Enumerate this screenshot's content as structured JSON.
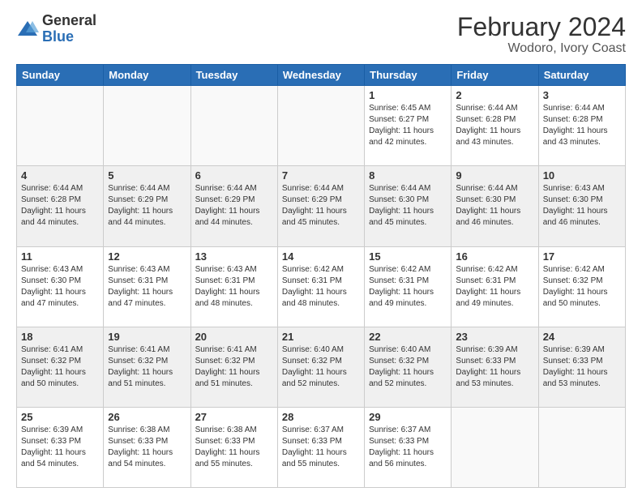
{
  "logo": {
    "general": "General",
    "blue": "Blue"
  },
  "header": {
    "title": "February 2024",
    "subtitle": "Wodoro, Ivory Coast"
  },
  "days_of_week": [
    "Sunday",
    "Monday",
    "Tuesday",
    "Wednesday",
    "Thursday",
    "Friday",
    "Saturday"
  ],
  "weeks": [
    [
      {
        "day": "",
        "info": ""
      },
      {
        "day": "",
        "info": ""
      },
      {
        "day": "",
        "info": ""
      },
      {
        "day": "",
        "info": ""
      },
      {
        "day": "1",
        "info": "Sunrise: 6:45 AM\nSunset: 6:27 PM\nDaylight: 11 hours and 42 minutes."
      },
      {
        "day": "2",
        "info": "Sunrise: 6:44 AM\nSunset: 6:28 PM\nDaylight: 11 hours and 43 minutes."
      },
      {
        "day": "3",
        "info": "Sunrise: 6:44 AM\nSunset: 6:28 PM\nDaylight: 11 hours and 43 minutes."
      }
    ],
    [
      {
        "day": "4",
        "info": "Sunrise: 6:44 AM\nSunset: 6:28 PM\nDaylight: 11 hours and 44 minutes."
      },
      {
        "day": "5",
        "info": "Sunrise: 6:44 AM\nSunset: 6:29 PM\nDaylight: 11 hours and 44 minutes."
      },
      {
        "day": "6",
        "info": "Sunrise: 6:44 AM\nSunset: 6:29 PM\nDaylight: 11 hours and 44 minutes."
      },
      {
        "day": "7",
        "info": "Sunrise: 6:44 AM\nSunset: 6:29 PM\nDaylight: 11 hours and 45 minutes."
      },
      {
        "day": "8",
        "info": "Sunrise: 6:44 AM\nSunset: 6:30 PM\nDaylight: 11 hours and 45 minutes."
      },
      {
        "day": "9",
        "info": "Sunrise: 6:44 AM\nSunset: 6:30 PM\nDaylight: 11 hours and 46 minutes."
      },
      {
        "day": "10",
        "info": "Sunrise: 6:43 AM\nSunset: 6:30 PM\nDaylight: 11 hours and 46 minutes."
      }
    ],
    [
      {
        "day": "11",
        "info": "Sunrise: 6:43 AM\nSunset: 6:30 PM\nDaylight: 11 hours and 47 minutes."
      },
      {
        "day": "12",
        "info": "Sunrise: 6:43 AM\nSunset: 6:31 PM\nDaylight: 11 hours and 47 minutes."
      },
      {
        "day": "13",
        "info": "Sunrise: 6:43 AM\nSunset: 6:31 PM\nDaylight: 11 hours and 48 minutes."
      },
      {
        "day": "14",
        "info": "Sunrise: 6:42 AM\nSunset: 6:31 PM\nDaylight: 11 hours and 48 minutes."
      },
      {
        "day": "15",
        "info": "Sunrise: 6:42 AM\nSunset: 6:31 PM\nDaylight: 11 hours and 49 minutes."
      },
      {
        "day": "16",
        "info": "Sunrise: 6:42 AM\nSunset: 6:31 PM\nDaylight: 11 hours and 49 minutes."
      },
      {
        "day": "17",
        "info": "Sunrise: 6:42 AM\nSunset: 6:32 PM\nDaylight: 11 hours and 50 minutes."
      }
    ],
    [
      {
        "day": "18",
        "info": "Sunrise: 6:41 AM\nSunset: 6:32 PM\nDaylight: 11 hours and 50 minutes."
      },
      {
        "day": "19",
        "info": "Sunrise: 6:41 AM\nSunset: 6:32 PM\nDaylight: 11 hours and 51 minutes."
      },
      {
        "day": "20",
        "info": "Sunrise: 6:41 AM\nSunset: 6:32 PM\nDaylight: 11 hours and 51 minutes."
      },
      {
        "day": "21",
        "info": "Sunrise: 6:40 AM\nSunset: 6:32 PM\nDaylight: 11 hours and 52 minutes."
      },
      {
        "day": "22",
        "info": "Sunrise: 6:40 AM\nSunset: 6:32 PM\nDaylight: 11 hours and 52 minutes."
      },
      {
        "day": "23",
        "info": "Sunrise: 6:39 AM\nSunset: 6:33 PM\nDaylight: 11 hours and 53 minutes."
      },
      {
        "day": "24",
        "info": "Sunrise: 6:39 AM\nSunset: 6:33 PM\nDaylight: 11 hours and 53 minutes."
      }
    ],
    [
      {
        "day": "25",
        "info": "Sunrise: 6:39 AM\nSunset: 6:33 PM\nDaylight: 11 hours and 54 minutes."
      },
      {
        "day": "26",
        "info": "Sunrise: 6:38 AM\nSunset: 6:33 PM\nDaylight: 11 hours and 54 minutes."
      },
      {
        "day": "27",
        "info": "Sunrise: 6:38 AM\nSunset: 6:33 PM\nDaylight: 11 hours and 55 minutes."
      },
      {
        "day": "28",
        "info": "Sunrise: 6:37 AM\nSunset: 6:33 PM\nDaylight: 11 hours and 55 minutes."
      },
      {
        "day": "29",
        "info": "Sunrise: 6:37 AM\nSunset: 6:33 PM\nDaylight: 11 hours and 56 minutes."
      },
      {
        "day": "",
        "info": ""
      },
      {
        "day": "",
        "info": ""
      }
    ]
  ]
}
